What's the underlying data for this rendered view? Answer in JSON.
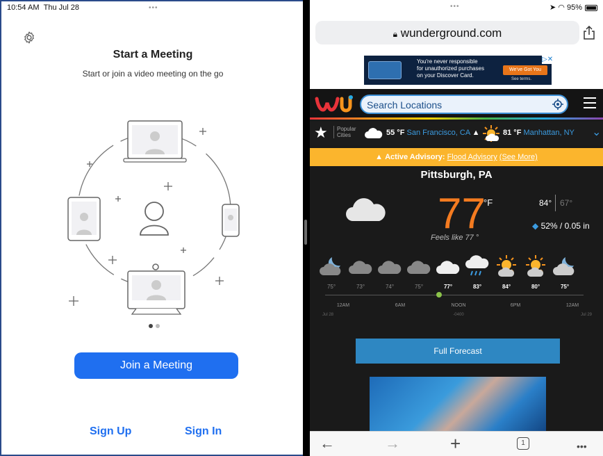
{
  "left": {
    "status": {
      "time": "10:54 AM",
      "date": "Thu Jul 28"
    },
    "dots": "•••",
    "title": "Start a Meeting",
    "subtitle": "Start or join a video meeting on the go",
    "join_label": "Join a Meeting",
    "sign_up_label": "Sign Up",
    "sign_in_label": "Sign In",
    "accent": "#1f6ff0"
  },
  "right": {
    "dots": "•••",
    "battery_text": "95%",
    "url": "wunderground.com",
    "ad": {
      "text_line1": "You're never responsible",
      "text_line2": "for unauthorized purchases",
      "text_line3": "on your Discover Card.",
      "button": "We've Got You",
      "terms": "See terms."
    },
    "search": {
      "placeholder": "Search Locations"
    },
    "popular_label_1": "Popular",
    "popular_label_2": "Cities",
    "cities": [
      {
        "temp": "55 °F",
        "name": "San Francisco, CA"
      },
      {
        "temp": "81 °F",
        "name": "Manhattan, NY"
      }
    ],
    "advisory": {
      "prefix": "Active Advisory:",
      "link": "Flood Advisory",
      "more": "(See More)"
    },
    "location": "Pittsburgh, PA",
    "temp": "77",
    "unit": "°F",
    "high": "84°",
    "low": "67°",
    "precip": "52% / 0.05 in",
    "feels_like": "Feels like 77 °",
    "hourly_temps": [
      "75°",
      "73°",
      "74°",
      "75°",
      "77°",
      "83°",
      "84°",
      "80°",
      "75°"
    ],
    "time_labels": [
      "12AM",
      "6AM",
      "NOON",
      "6PM",
      "12AM"
    ],
    "time_sub": {
      "start": "Jul 28",
      "noon": "-0400",
      "end": "Jul 29"
    },
    "forecast_label": "Full Forecast",
    "tab_count": "1",
    "accent_orange": "#f47b20",
    "advisory_color": "#fbb52d"
  }
}
